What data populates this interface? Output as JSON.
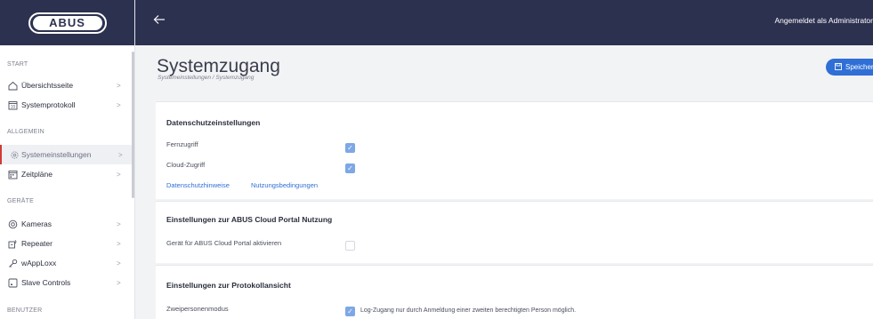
{
  "brand": {
    "logo_text": "ABUS"
  },
  "topbar": {
    "back_icon": "arrow-left-icon",
    "user_text": "Angemeldet als Administrator"
  },
  "sidebar": {
    "sections": [
      {
        "label": "START"
      },
      {
        "label": "ALLGEMEIN"
      },
      {
        "label": "GERÄTE"
      },
      {
        "label": "BENUTZER"
      }
    ],
    "items": [
      {
        "label": "Übersichtsseite",
        "icon": "home-icon"
      },
      {
        "label": "Systemprotokoll",
        "icon": "calendar-icon"
      },
      {
        "label": "Systemeinstellungen",
        "icon": "gear-icon",
        "active": true
      },
      {
        "label": "Zeitpläne",
        "icon": "schedule-icon"
      },
      {
        "label": "Kameras",
        "icon": "camera-icon"
      },
      {
        "label": "Repeater",
        "icon": "repeater-icon"
      },
      {
        "label": "wAppLoxx",
        "icon": "key-icon"
      },
      {
        "label": "Slave Controls",
        "icon": "slave-control-icon"
      }
    ],
    "chevron": ">"
  },
  "header": {
    "title": "Systemzugang",
    "breadcrumb": "Systemeinstellungen / Systemzugang",
    "save_label": "Speichern"
  },
  "privacy": {
    "title": "Datenschutzeinstellungen",
    "remote_access_label": "Fernzugriff",
    "remote_access_checked": true,
    "cloud_access_label": "Cloud-Zugriff",
    "cloud_access_checked": true,
    "privacy_link": "Datenschutzhinweise",
    "terms_link": "Nutzungsbedingungen"
  },
  "cloud_portal": {
    "title": "Einstellungen zur ABUS Cloud Portal Nutzung",
    "activate_label": "Gerät für ABUS Cloud Portal aktivieren",
    "activate_checked": false
  },
  "log_view": {
    "title": "Einstellungen zur Protokollansicht",
    "two_person_label": "Zweipersonenmodus",
    "two_person_checked": true,
    "two_person_text": "Log-Zugang nur durch Anmeldung einer zweiten berechtigten Person möglich."
  },
  "colors": {
    "navy": "#2d3150",
    "accent_blue": "#2f6fd6",
    "active_marker": "#d33a32",
    "checkbox_on": "#7ea7e6"
  }
}
